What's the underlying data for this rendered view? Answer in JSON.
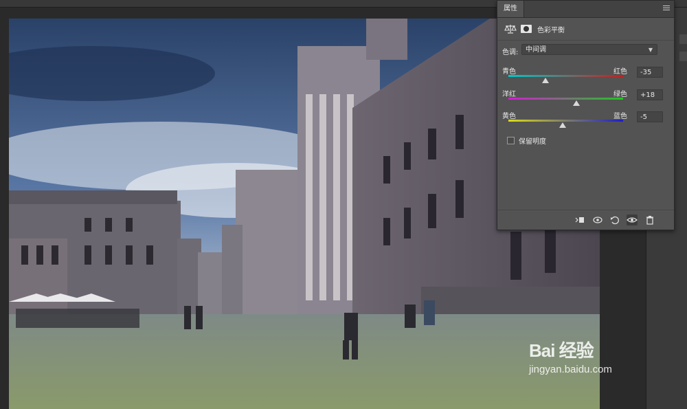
{
  "panel": {
    "tab_label": "属性",
    "adjustment_title": "色彩平衡",
    "tone_label": "色调:",
    "tone_value": "中间调",
    "sliders": [
      {
        "left": "青色",
        "right": "红色",
        "value": "-35",
        "numeric": -35,
        "gradient": [
          "#00c8c8",
          "#c81e1e"
        ]
      },
      {
        "left": "洋红",
        "right": "绿色",
        "value": "+18",
        "numeric": 18,
        "gradient": [
          "#d21ed2",
          "#1ec81e"
        ]
      },
      {
        "left": "黄色",
        "right": "蓝色",
        "value": "-5",
        "numeric": -5,
        "gradient": [
          "#dcdc14",
          "#1e1ec8"
        ]
      }
    ],
    "preserve_luminosity_label": "保留明度",
    "preserve_luminosity_checked": false
  },
  "watermark": {
    "logo_text": "Bai 经验",
    "url": "jingyan.baidu.com"
  }
}
